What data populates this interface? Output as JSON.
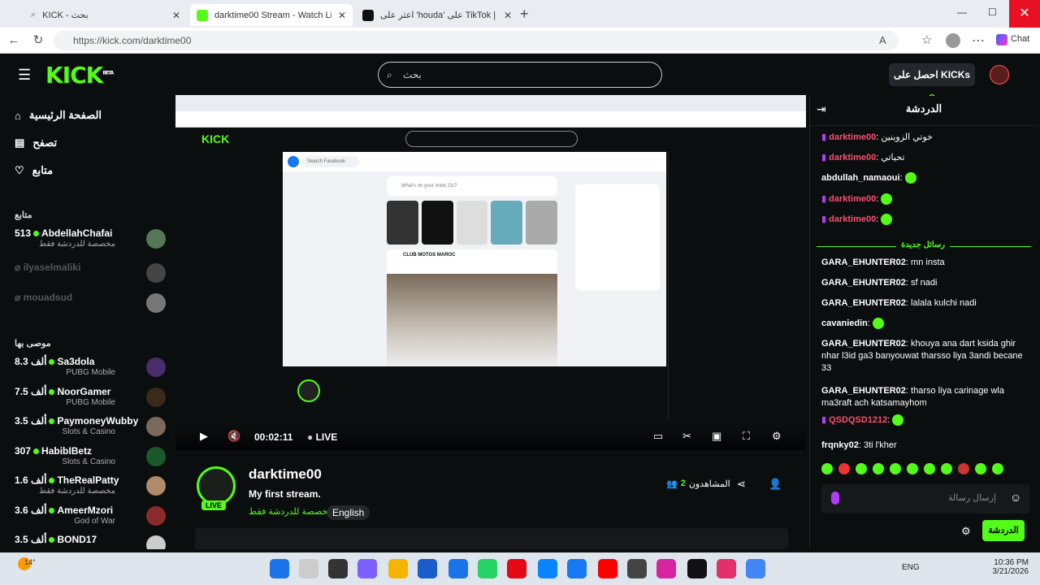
{
  "browser": {
    "tabs": [
      {
        "label": "KICK - بحث"
      },
      {
        "label": "darktime00 Stream - Watch Live o"
      },
      {
        "label": "اعثر على 'houda' على TikTok | بحث"
      }
    ],
    "url": "https://kick.com/darktime00",
    "chat_label": "Chat"
  },
  "header": {
    "logo": "KICK",
    "beta": "BETA",
    "search_placeholder": "بحث",
    "get_kicks": "احصل على KICKs"
  },
  "sidebar": {
    "nav": [
      {
        "label": "الصفحة الرئيسية",
        "icon": "home-icon"
      },
      {
        "label": "تصفح",
        "icon": "browse-icon"
      },
      {
        "label": "متابع",
        "icon": "heart-icon"
      }
    ],
    "following_title": "متابع",
    "following": [
      {
        "count": "513",
        "name": "AbdellahChafai",
        "sub": "مخصصة للدردشة فقط"
      },
      {
        "name": "ilyaselmaliki"
      },
      {
        "name": "mouadsud"
      }
    ],
    "recommended_title": "موصى بها",
    "recommended": [
      {
        "count": "8.3 ألف",
        "name": "Sa3dola",
        "sub": "PUBG Mobile"
      },
      {
        "count": "7.5 ألف",
        "name": "NoorGamer",
        "sub": "PUBG Mobile"
      },
      {
        "count": "3.5 ألف",
        "name": "PaymoneyWubby",
        "sub": "Slots & Casino"
      },
      {
        "count": "307",
        "name": "HabibIBetz",
        "sub": "Slots & Casino"
      },
      {
        "count": "1.6 ألف",
        "name": "TheRealPatty",
        "sub": "مخصصة للدردشة فقط"
      },
      {
        "count": "3.6 ألف",
        "name": "AmeerMzori",
        "sub": "God of War"
      },
      {
        "count": "3.5 ألف",
        "name": "BOND17"
      }
    ]
  },
  "player": {
    "time": "00:02:11",
    "live": "LIVE",
    "inner_facebook_search": "Search Facebook",
    "inner_post": "What's on your mind, Dz?",
    "inner_page": "CLUB MOTOS MAROC"
  },
  "stream": {
    "channel": "darktime00",
    "title": "My first stream.",
    "category": "مخصصة للدردشة فقط",
    "language": "English",
    "live_badge": "LIVE",
    "viewers_label": "المشاهدون",
    "viewers": "2"
  },
  "chat": {
    "title": "الدردشة",
    "new_messages": "رسائل جديدة",
    "input_placeholder": "إرسال رسالة",
    "send_button": "الدردشة",
    "messages": [
      {
        "user": "darktime00",
        "text": "خوتي الزوينين",
        "color": "#ff4d6d"
      },
      {
        "user": "darktime00",
        "text": "تحياتي",
        "color": "#ff4d6d"
      },
      {
        "user": "abdullah_namaoui",
        "text": "",
        "color": "#ffffff"
      },
      {
        "user": "darktime00",
        "text": "",
        "color": "#ff4d6d"
      },
      {
        "user": "darktime00",
        "text": "",
        "color": "#ff4d6d"
      },
      {
        "user": "GARA_EHUNTER02",
        "text": "mn insta",
        "color": "#ffffff"
      },
      {
        "user": "GARA_EHUNTER02",
        "text": "sf nadi",
        "color": "#ffffff"
      },
      {
        "user": "GARA_EHUNTER02",
        "text": "lalala kulchi nadi",
        "color": "#ffffff"
      },
      {
        "user": "cavaniedin",
        "text": "",
        "color": "#ffffff"
      },
      {
        "user": "GARA_EHUNTER02",
        "text": "khouya ana dart ksida ghir nhar l3id ga3 banyouwat tharsso liya 3andi becane 33",
        "color": "#ffffff"
      },
      {
        "user": "GARA_EHUNTER02",
        "text": "tharso liya carinage wla ma3raft ach katsamayhom",
        "color": "#ffffff"
      },
      {
        "user": "QSDQSD1212",
        "text": "",
        "color": "#ff4d6d"
      },
      {
        "user": "frqnky02",
        "text": "3ti l'kher",
        "color": "#ffffff"
      }
    ]
  },
  "taskbar": {
    "temp": "14°",
    "lang": "ENG",
    "time": "10:36 PM",
    "date": "3/21/2026"
  },
  "colors": {
    "kick_green": "#53fc18",
    "bg": "#0b0e0f"
  }
}
